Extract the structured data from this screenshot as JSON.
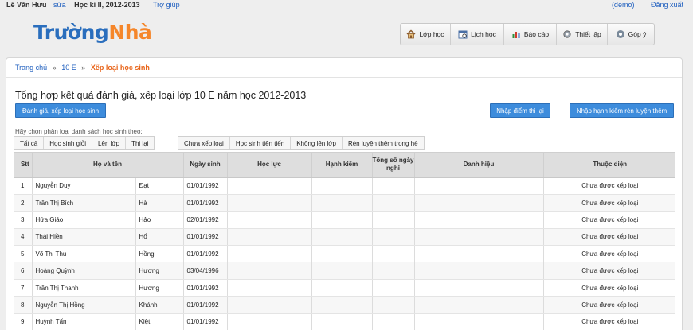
{
  "topbar": {
    "user": "Lê Văn Hưu",
    "edit_link": "sửa",
    "term": "Học kì II, 2012-2013",
    "help_link": "Trợ giúp",
    "demo": "(demo)",
    "logout": "Đăng xuất"
  },
  "logo": {
    "part1": "Trường",
    "part2": "Nhà"
  },
  "nav": [
    {
      "label": "Lớp học",
      "icon": "home-icon"
    },
    {
      "label": "Lịch học",
      "icon": "calendar-icon"
    },
    {
      "label": "Báo cáo",
      "icon": "bar-chart-icon"
    },
    {
      "label": "Thiết lập",
      "icon": "gear-icon"
    },
    {
      "label": "Góp ý",
      "icon": "feedback-icon"
    }
  ],
  "breadcrumb": {
    "home": "Trang chủ",
    "sep": "»",
    "class": "10 E",
    "current": "Xếp loại học sinh"
  },
  "page_title": "Tổng hợp kết quả đánh giá, xếp loại lớp 10 E năm học 2012-2013",
  "buttons": {
    "evaluate": "Đánh giá, xếp loại học sinh",
    "retest": "Nhập điểm thi lại",
    "conduct_training": "Nhập hạnh kiểm rèn luyện thêm"
  },
  "filter_hint": "Hãy chọn phân loại danh sách học sinh theo:",
  "filters_group1": [
    "Tất cả",
    "Học sinh giỏi",
    "Lên lớp",
    "Thi lại"
  ],
  "filters_group2": [
    "Chưa xếp loại",
    "Học sinh tiên tiến",
    "Không lên lớp",
    "Rèn luyện thêm trong hè"
  ],
  "table": {
    "headers": {
      "stt": "Stt",
      "name": "Họ và tên",
      "dob": "Ngày sinh",
      "academic": "Học lực",
      "conduct": "Hạnh kiểm",
      "absent": "Tổng số ngày nghỉ",
      "title": "Danh hiệu",
      "category": "Thuộc diện"
    },
    "rows": [
      {
        "stt": "1",
        "ho": "Nguyễn Duy",
        "ten": "Đạt",
        "dob": "01/01/1992",
        "category": "Chưa được xếp loại"
      },
      {
        "stt": "2",
        "ho": "Trần Thị Bích",
        "ten": "Hà",
        "dob": "01/01/1992",
        "category": "Chưa được xếp loại"
      },
      {
        "stt": "3",
        "ho": "Hứa Giáo",
        "ten": "Hảo",
        "dob": "02/01/1992",
        "category": "Chưa được xếp loại"
      },
      {
        "stt": "4",
        "ho": "Thái Hiền",
        "ten": "Hổ",
        "dob": "01/01/1992",
        "category": "Chưa được xếp loại"
      },
      {
        "stt": "5",
        "ho": "Võ Thị Thu",
        "ten": "Hồng",
        "dob": "01/01/1992",
        "category": "Chưa được xếp loại"
      },
      {
        "stt": "6",
        "ho": "Hoàng Quỳnh",
        "ten": "Hương",
        "dob": "03/04/1996",
        "category": "Chưa được xếp loại"
      },
      {
        "stt": "7",
        "ho": "Trần Thị Thanh",
        "ten": "Hương",
        "dob": "01/01/1992",
        "category": "Chưa được xếp loại"
      },
      {
        "stt": "8",
        "ho": "Nguyễn Thị Hồng",
        "ten": "Khánh",
        "dob": "01/01/1992",
        "category": "Chưa được xếp loại"
      },
      {
        "stt": "9",
        "ho": "Huỳnh Tấn",
        "ten": "Kiệt",
        "dob": "01/01/1992",
        "category": "Chưa được xếp loại"
      }
    ]
  },
  "colors": {
    "primary_button": "#3d8cdc",
    "logo_blue": "#2a6ebd",
    "logo_orange": "#f5862a",
    "breadcrumb_current": "#e8651a"
  }
}
